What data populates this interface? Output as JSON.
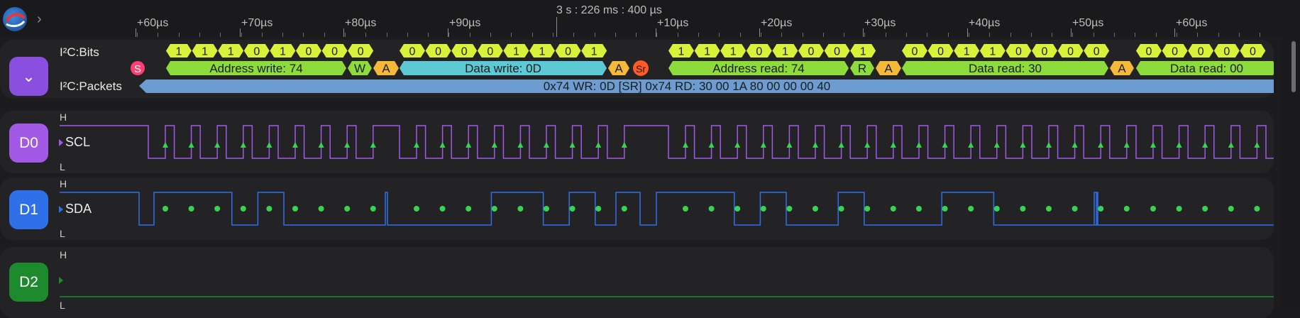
{
  "ruler": {
    "reference": "3 s : 226 ms : 400 µs",
    "ticks": [
      "+60µs",
      "+70µs",
      "+80µs",
      "+90µs",
      "+10µs",
      "+20µs",
      "+30µs",
      "+40µs",
      "+50µs",
      "+60µs"
    ]
  },
  "analyzer": {
    "bits_label": "I²C:Bits",
    "packets_label": "I²C:Packets",
    "toggle_icon": "chevron-down-icon",
    "packet_summary": "0x74 WR: 0D [SR] 0x74 RD: 30 00 1A 80 00 00 00 40",
    "bit_groups": [
      [
        "1",
        "1",
        "1",
        "0",
        "1",
        "0",
        "0",
        "0"
      ],
      [
        "0",
        "0",
        "0",
        "0",
        "1",
        "1",
        "0",
        "1"
      ],
      [
        "1",
        "1",
        "1",
        "0",
        "1",
        "0",
        "0",
        "1"
      ],
      [
        "0",
        "0",
        "1",
        "1",
        "0",
        "0",
        "0",
        "0"
      ],
      [
        "0",
        "0",
        "0",
        "0",
        "0"
      ]
    ],
    "frames": {
      "start": "S",
      "addr_write": "Address write: 74",
      "w": "W",
      "ack1": "A",
      "data_write": "Data write: 0D",
      "ack2": "A",
      "restart": "Sr",
      "addr_read": "Address read: 74",
      "r": "R",
      "ack3": "A",
      "data_read1": "Data read: 30",
      "ack4": "A",
      "data_read2": "Data read: 00"
    }
  },
  "channels": [
    {
      "badge": "D0",
      "name": "SCL",
      "high": "H",
      "low": "L",
      "color": "#a259e6"
    },
    {
      "badge": "D1",
      "name": "SDA",
      "high": "H",
      "low": "L",
      "color": "#2f6fe8"
    },
    {
      "badge": "D2",
      "name": "",
      "high": "H",
      "low": "L",
      "color": "#1e8a2e"
    }
  ],
  "colors": {
    "bits": "#d8f23a",
    "address": "#8ddc3c",
    "data": "#5cc9d4",
    "ack": "#f5b93a",
    "start": "#ff3f74",
    "restart": "#ff5a28",
    "packet": "#6c9cd0",
    "scl_marker": "#39d353",
    "sda_dot": "#39d353"
  }
}
